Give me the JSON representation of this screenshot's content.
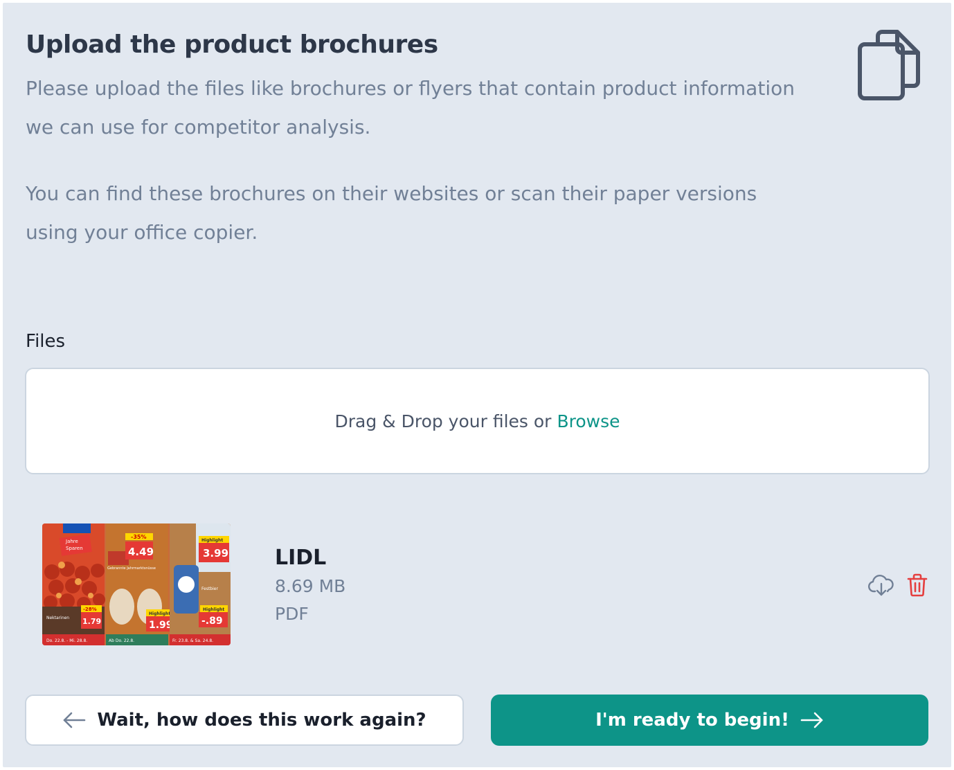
{
  "header": {
    "title": "Upload the product brochures",
    "description_1": "Please upload the files like brochures or flyers that contain product information we can use for competitor analysis.",
    "description_2": "You can find these brochures on their websites or scan their paper versions using your office copier.",
    "icon": "document-copy-icon"
  },
  "files_section": {
    "label": "Files",
    "dropzone_text": "Drag & Drop your files or",
    "browse_label": "Browse"
  },
  "uploaded_files": [
    {
      "name": "LIDL",
      "size": "8.69 MB",
      "type": "PDF",
      "thumbnail_icon": "brochure-thumbnail",
      "thumbnail_text": {
        "badge_1": "Jahre",
        "badge_2": "Sparen",
        "disc_1": "-35%",
        "price_1": "4.49",
        "tag_1": "Highlight",
        "price_2": "3.99",
        "heading_1": "Gebrannte Jahrmarktsnüsse",
        "label_1": "Festbier",
        "disc_2": "-28%",
        "label_2": "Nektarinen",
        "price_3": "1.79",
        "tag_2": "Highlight",
        "price_4": "1.99",
        "tag_3": "Highlight",
        "price_5": "-.89",
        "foot_1": "Do. 22.8. - Mi. 28.8.",
        "foot_2": "Ab Do. 22.8.",
        "foot_3": "Fr. 23.8. & Sa. 24.8."
      },
      "actions": [
        "download-icon",
        "trash-icon"
      ]
    }
  ],
  "footer": {
    "back_label": "Wait, how does this work again?",
    "next_label": "I'm ready to begin!"
  },
  "colors": {
    "panel_bg": "#e2e8f0",
    "accent": "#0d9488",
    "danger": "#e53e3e",
    "muted_text": "#718096"
  }
}
